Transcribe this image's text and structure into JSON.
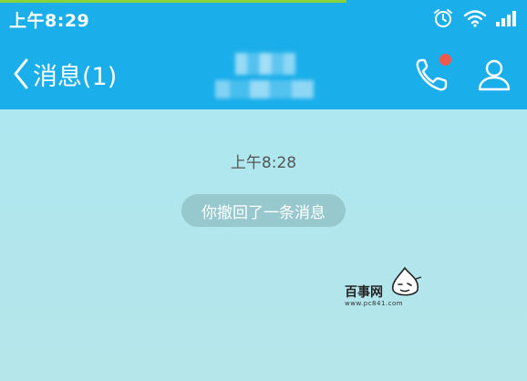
{
  "status_bar": {
    "time": "上午8:29",
    "icons": [
      "alarm-clock-icon",
      "wifi-icon",
      "signal-icon"
    ]
  },
  "nav": {
    "back_label": "消息(1)",
    "icons": [
      "phone-icon",
      "profile-icon"
    ],
    "call_badge_color": "#f05a4a"
  },
  "chat": {
    "timestamp": "上午8:28",
    "system_message": "你撤回了一条消息"
  },
  "watermark": {
    "text": "百事网",
    "url": "www.pc841.com"
  },
  "colors": {
    "header": "#1aaeea",
    "chat_background": "#aee7ef",
    "progress": "#8ad23a"
  }
}
